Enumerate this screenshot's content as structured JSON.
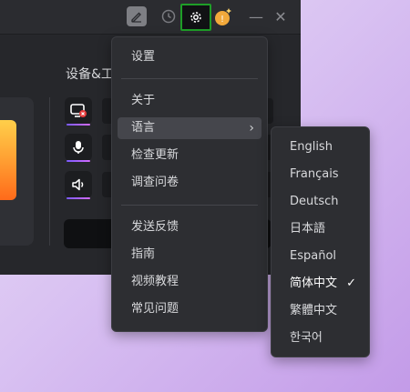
{
  "toolbar": {
    "pen_icon": "pen-icon",
    "clock_icon": "clock-icon",
    "gear_icon": "gear-icon",
    "coin_icon": "coin-icon",
    "minimize_glyph": "—",
    "close_glyph": "✕",
    "highlight_color": "#1e9e27"
  },
  "main": {
    "section_title": "设备&工"
  },
  "menu": {
    "items": [
      {
        "label": "设置"
      },
      {
        "label": "关于"
      },
      {
        "label": "语言",
        "has_submenu": true,
        "chevron": "›"
      },
      {
        "label": "检查更新"
      },
      {
        "label": "调查问卷"
      },
      {
        "label": "发送反馈"
      },
      {
        "label": "指南"
      },
      {
        "label": "视频教程"
      },
      {
        "label": "常见问题"
      }
    ]
  },
  "language_menu": {
    "items": [
      {
        "label": "English"
      },
      {
        "label": "Français"
      },
      {
        "label": "Deutsch"
      },
      {
        "label": "日本語"
      },
      {
        "label": "Español"
      },
      {
        "label": "简体中文",
        "selected": true,
        "check": "✓"
      },
      {
        "label": "繁體中文"
      },
      {
        "label": "한국어"
      }
    ]
  }
}
